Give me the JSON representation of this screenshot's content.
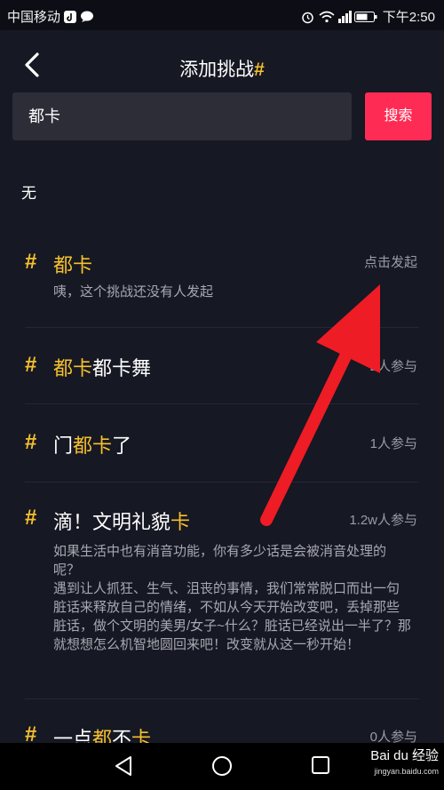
{
  "status_bar": {
    "carrier": "中国移动",
    "time": "下午2:50"
  },
  "header": {
    "title": "添加挑战",
    "title_hash": "#"
  },
  "search": {
    "value": "都卡",
    "button_label": "搜索"
  },
  "section_label": "无",
  "items": [
    {
      "title_highlight": "都卡",
      "title_rest": "",
      "meta": "点击发起",
      "desc": "咦，这个挑战还没有人发起"
    },
    {
      "title_highlight": "都卡",
      "title_rest": "都卡舞",
      "meta": "2人参与"
    },
    {
      "title_prefix": "门",
      "title_highlight": "都卡",
      "title_rest": "了",
      "meta": "1人参与"
    },
    {
      "title_prefix": "滴！文明礼貌",
      "title_highlight": "卡",
      "meta": "1.2w人参与",
      "desc": "如果生活中也有消音功能，你有多少话是会被消音处理的呢？\n遇到让人抓狂、生气、沮丧的事情，我们常常脱口而出一句脏话来释放自己的情绪，不如从今天开始改变吧，丢掉那些脏话，做个文明的美男/女子~什么？脏话已经说出一半了？那就想想怎么机智地圆回来吧！改变就从这一秒开始！"
    },
    {
      "title_prefix": "一点",
      "title_highlight": "都",
      "title_mid": "不",
      "title_highlight2": "卡",
      "meta": "0人参与"
    }
  ],
  "watermark": {
    "brand": "Bai du 经验",
    "url": "jingyan.baidu.com"
  },
  "colors": {
    "background": "#161823",
    "accent_yellow": "#f6c02d",
    "search_button": "#fe2c55",
    "annotation_arrow": "#ee1c24"
  }
}
